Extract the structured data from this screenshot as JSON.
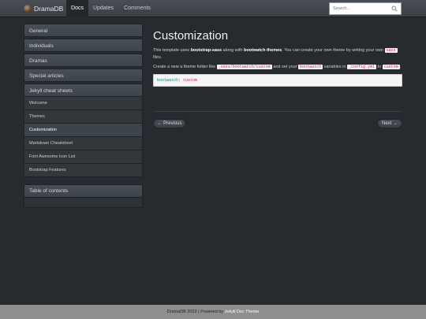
{
  "header": {
    "brand": "DramaDB",
    "nav": [
      {
        "label": "Docs",
        "active": true
      },
      {
        "label": "Updates",
        "active": false
      },
      {
        "label": "Comments",
        "active": false
      }
    ],
    "search_placeholder": "Search..."
  },
  "sidebar": {
    "sections": [
      "General",
      "Individuals",
      "Dramas",
      "Special articles",
      "Jekyll cheat sheets"
    ],
    "subitems": [
      "Welcome",
      "Themes",
      "Customization",
      "Markdown Cheatsheet",
      "Font Awesome Icon List",
      "Bootstrap Features"
    ],
    "active_subitem": "Customization",
    "toc_title": "Table of contents"
  },
  "content": {
    "title": "Customization",
    "p1": {
      "t1": "This template uses ",
      "b1": "bootstrap-sass",
      "t2": " along with ",
      "b2": "bootwatch themes",
      "t3": ". You can create your own theme by writing your own ",
      "c1": "sass",
      "t4": " files."
    },
    "p2": {
      "t1": "Create a new a theme folder like ",
      "c1": "_sass/bootwatch/custom",
      "t2": " and set your ",
      "c2": "bootwatch",
      "t3": " variables in ",
      "c3": "_config.yml",
      "t4": " to ",
      "c4": "custom",
      "t5": "."
    },
    "code": {
      "key": "bootwatch:",
      "value": "custom"
    },
    "prev": "← Previous",
    "next": "Next →"
  },
  "footer": {
    "text": "DramaDB 2023 | Powered by ",
    "link": "Jekyll Doc Theme"
  },
  "colors": {
    "background": "#272b30",
    "navbar": "#3a3f44",
    "footer": "#8e8e8e",
    "code_text": "#c7254e",
    "code_bg": "#f9f2f4"
  },
  "icons": {
    "brand": "brand-logo-icon",
    "search": "search-icon"
  }
}
